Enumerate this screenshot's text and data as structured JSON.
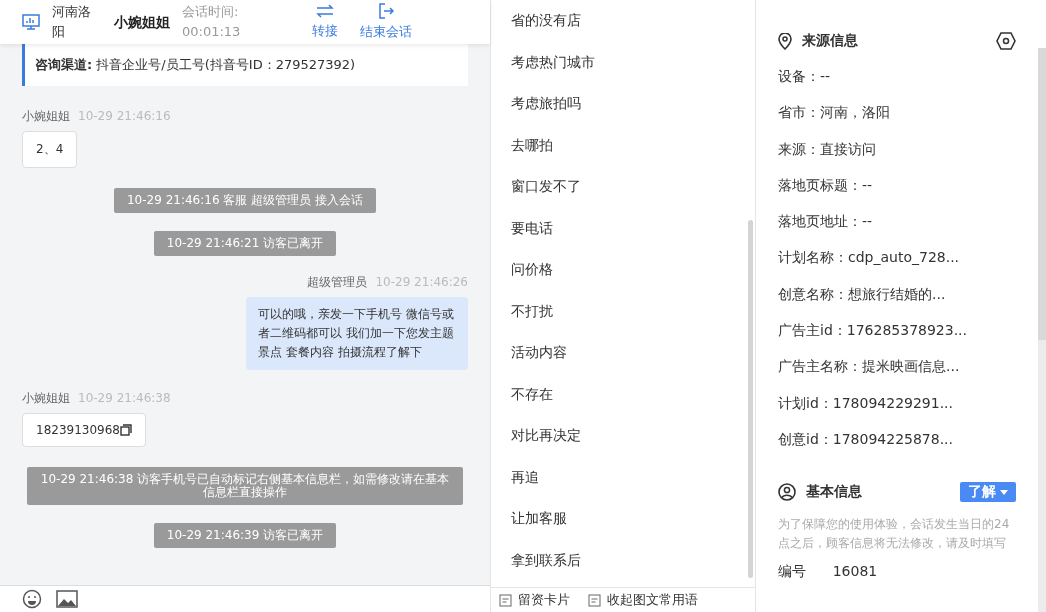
{
  "header": {
    "location": "河南洛阳",
    "visitor": "小婉姐姐",
    "session_label": "会话时间:",
    "session_time": "00:01:13",
    "actions": [
      {
        "kind": "transfer",
        "label": "转接"
      },
      {
        "kind": "end",
        "label": "结束会话"
      }
    ]
  },
  "channel_card": {
    "label": "咨询渠道:",
    "value": "抖音企业号/员工号(抖音号ID：279527392)"
  },
  "messages": [
    {
      "kind": "visitor",
      "name": "小婉姐姐",
      "time": "10-29 21:46:16",
      "text": "2、4",
      "copy": false
    },
    {
      "kind": "system",
      "text": "10-29 21:46:16 客服 超级管理员 接入会话"
    },
    {
      "kind": "system",
      "text": "10-29 21:46:21 访客已离开"
    },
    {
      "kind": "agent",
      "name": "超级管理员",
      "time": "10-29 21:46:26",
      "text": "可以的哦，亲发一下手机号 微信号或者二维码都可以 我们加一下您发主题景点 套餐内容 拍摄流程了解下"
    },
    {
      "kind": "visitor",
      "name": "小婉姐姐",
      "time": "10-29 21:46:38",
      "text": "18239130968",
      "copy": true
    },
    {
      "kind": "system",
      "text": "10-29 21:46:38 访客手机号已自动标记右侧基本信息栏，如需修改请在基本信息栏直接操作"
    },
    {
      "kind": "system",
      "text": "10-29 21:46:39 访客已离开"
    }
  ],
  "quick_replies": [
    "省的没有店",
    "考虑热门城市",
    "考虑旅拍吗",
    "去哪拍",
    "窗口发不了",
    "要电话",
    "问价格",
    "不打扰",
    "活动内容",
    "不存在",
    "对比再决定",
    "再追",
    "让加客服",
    "拿到联系后"
  ],
  "quick_actions": [
    "留资卡片",
    "收起图文常用语"
  ],
  "source_info": {
    "title": "来源信息",
    "rows": [
      "设备：--",
      "省市：河南，洛阳",
      "来源：直接访问",
      "落地页标题：--",
      "落地页地址：--",
      "计划名称：cdp_auto_728...",
      "创意名称：想旅行结婚的...",
      "广告主id：176285378923...",
      "广告主名称：提米映画信息...",
      "计划id：178094229291...",
      "创意id：178094225878..."
    ]
  },
  "basic_info": {
    "title": "基本信息",
    "button": "了解",
    "note": "为了保障您的使用体验，会话发生当日的24点之后，顾客信息将无法修改，请及时填写",
    "rows": [
      {
        "label": "编号",
        "value": "16081"
      }
    ]
  }
}
